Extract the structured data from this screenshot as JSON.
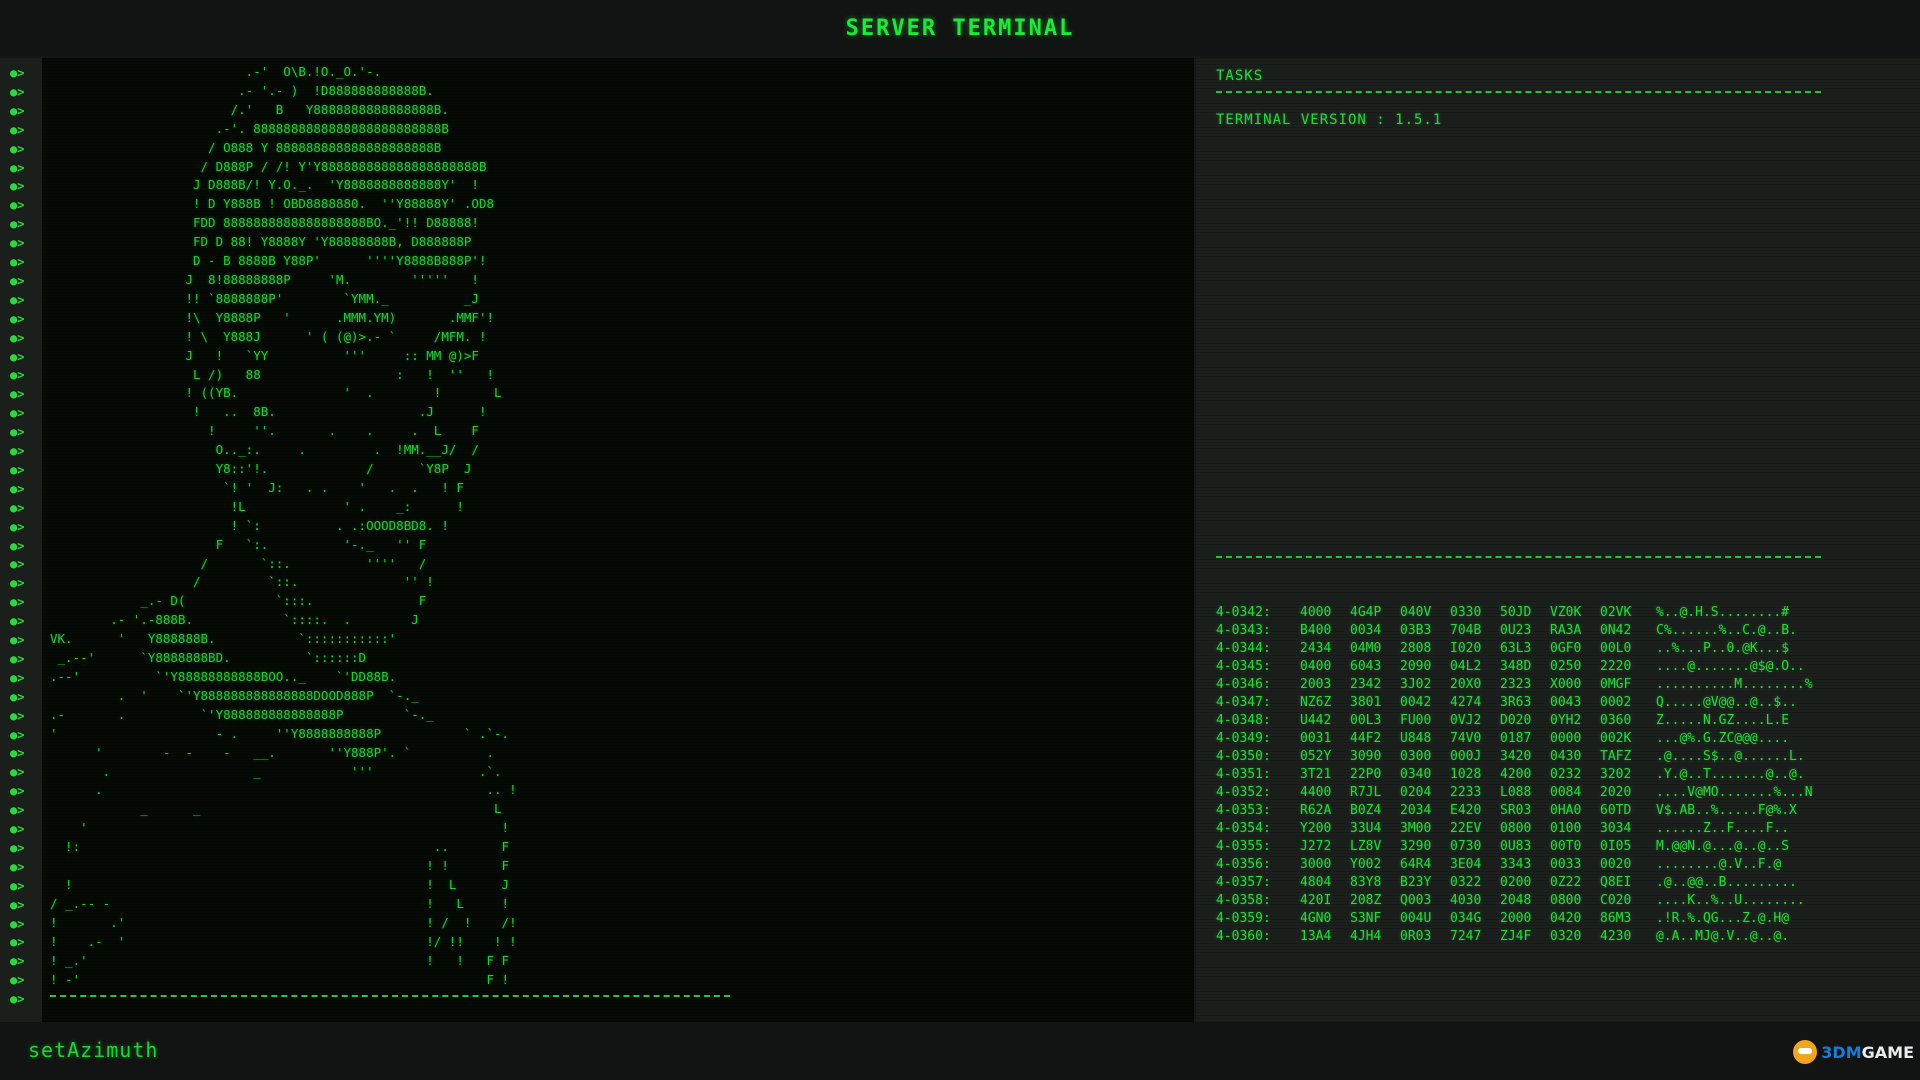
{
  "window": {
    "title": "SERVER TERMINAL"
  },
  "terminal": {
    "prompt_symbol": "●>",
    "line_count": 50,
    "ascii_art": "                          .-'  O\\B.!O._O.'-.\n                         .- '.- )  !D888888888888B.\n                        /.'   B   Y8888888888888888B.\n                      .-'. 8888888888888888888888888B\n                     / O888 Y 888888888888888888888B\n                    / D888P / /! Y'Y888888888888888888888B\n                   J D888B/! Y.O._.  'Y8888888888888Y'  !\n                   ! D Y888B ! OBD8888880.  ''Y88888Y' .OD8\n                   FDD 8888888888888888888BO._'!! D88888!\n                   FD D 88! Y8888Y 'Y88888888B, D888888P\n                   D - B 8888B Y88P'      ''''Y8888B888P'!\n                  J  8!88888888P     'M.        '''''   !\n                  !! `8888888P'        `YMM._          _J\n                  !\\  Y8888P   '      .MMM.YM)       .MMF'!\n                  ! \\  Y888J      ' ( (@)>.- `     /MFM. !\n                  J   !   `YY          '''     :: MM @)>F\n                   L /)   88                  :   !  ''   !\n                  ! ((YB.              '  .        !       L\n                   !   ..  8B.                   .J      !\n                     !     ''.       .    .     .  L    F\n                      O.._:.     .         .  !MM.__J/  /\n                      Y8::'!.             /      `Y8P  J\n                       `! '  J:   . .    '   .  .   ! F\n                        !L             ' .    _:      !\n                        ! `:          . .:OOOD8BD8. !\n                      F   `:.          '-._   '' F\n                    /       `::.          ''''   /\n                   /         `::.              '' !\n            _.- D(            `:::.              F\n        .- '.-888B.            `::::.  .        J\nVK.      '   Y888888B.           `:::::::::::'\n _.--'      `Y8888888BD.          `::::::D\n.--'          `'Y88888888888BOO.._    `'DD88B.\n         .  '    `'Y888888888888888DOOD888P  `-._\n.-       .          `'Y888888888888888P        `-._\n'                     - .     ''Y8888888888P           ` .`-.\n      '        -  -    -   __.       ''Y888P'. `          .\n       .                   _            '''              .`.\n      .                                                   .. !\n            _      _                                       L\n    '                                                       !\n  !:                                               ..       F\n                                                  ! !       F\n  !                                               !  L      J\n/ _.-- -                                          !   L     !\n!       .'                                        ! /  !    /!\n!    .-  '                                        !/ !!    ! !\n! _.'                                             !   !   F F\n! -'                                                      F !"
  },
  "side_panel": {
    "heading": "TASKS",
    "version_text": "TERMINAL VERSION : 1.5.1",
    "hex_rows": [
      {
        "addr": "4-0342:",
        "words": [
          "4000",
          "4G4P",
          "040V",
          "0330",
          "50JD",
          "VZ0K",
          "02VK"
        ],
        "ascii": "%..@.H.S........#"
      },
      {
        "addr": "4-0343:",
        "words": [
          "B400",
          "0034",
          "03B3",
          "704B",
          "0U23",
          "RA3A",
          "0N42"
        ],
        "ascii": "C%......%..C.@..B."
      },
      {
        "addr": "4-0344:",
        "words": [
          "2434",
          "04M0",
          "2808",
          "I020",
          "63L3",
          "0GF0",
          "00L0"
        ],
        "ascii": "..%...P..0.@K...$"
      },
      {
        "addr": "4-0345:",
        "words": [
          "0400",
          "6043",
          "2090",
          "04L2",
          "348D",
          "0250",
          "2220"
        ],
        "ascii": "....@.......@$@.O.."
      },
      {
        "addr": "4-0346:",
        "words": [
          "2003",
          "2342",
          "3J02",
          "20X0",
          "2323",
          "X000",
          "0MGF"
        ],
        "ascii": "..........M........%"
      },
      {
        "addr": "4-0347:",
        "words": [
          "NZ6Z",
          "3801",
          "0042",
          "4274",
          "3R63",
          "0043",
          "0002"
        ],
        "ascii": "Q.....@V@@..@..$.."
      },
      {
        "addr": "4-0348:",
        "words": [
          "U442",
          "00L3",
          "FU00",
          "0VJ2",
          "D020",
          "0YH2",
          "0360"
        ],
        "ascii": "Z.....N.GZ....L.E"
      },
      {
        "addr": "4-0349:",
        "words": [
          "0031",
          "44F2",
          "U848",
          "74V0",
          "0187",
          "0000",
          "002K"
        ],
        "ascii": "...@%.G.ZC@@@...."
      },
      {
        "addr": "4-0350:",
        "words": [
          "052Y",
          "3090",
          "0300",
          "000J",
          "3420",
          "0430",
          "TAFZ"
        ],
        "ascii": ".@....S$..@......L."
      },
      {
        "addr": "4-0351:",
        "words": [
          "3T21",
          "22P0",
          "0340",
          "1028",
          "4200",
          "0232",
          "3202"
        ],
        "ascii": ".Y.@..T.......@..@."
      },
      {
        "addr": "4-0352:",
        "words": [
          "4400",
          "R7JL",
          "0204",
          "2233",
          "L088",
          "0084",
          "2020"
        ],
        "ascii": "....V@MO.......%...N"
      },
      {
        "addr": "4-0353:",
        "words": [
          "R62A",
          "B0Z4",
          "2034",
          "E420",
          "SR03",
          "0HA0",
          "60TD"
        ],
        "ascii": "V$.AB..%.....F@%.X"
      },
      {
        "addr": "4-0354:",
        "words": [
          "Y200",
          "33U4",
          "3M00",
          "22EV",
          "0800",
          "0100",
          "3034"
        ],
        "ascii": "......Z..F....F.."
      },
      {
        "addr": "4-0355:",
        "words": [
          "J272",
          "LZ8V",
          "3290",
          "0730",
          "0U83",
          "00T0",
          "0I05"
        ],
        "ascii": "M.@@N.@...@..@..S"
      },
      {
        "addr": "4-0356:",
        "words": [
          "3000",
          "Y002",
          "64R4",
          "3E04",
          "3343",
          "0033",
          "0020"
        ],
        "ascii": "........@.V..F.@"
      },
      {
        "addr": "4-0357:",
        "words": [
          "4804",
          "83Y8",
          "B23Y",
          "0322",
          "0200",
          "0Z22",
          "Q8EI"
        ],
        "ascii": ".@..@@..B........."
      },
      {
        "addr": "4-0358:",
        "words": [
          "420I",
          "208Z",
          "Q003",
          "4030",
          "2048",
          "0800",
          "C020"
        ],
        "ascii": "....K..%..U........"
      },
      {
        "addr": "4-0359:",
        "words": [
          "4GN0",
          "S3NF",
          "004U",
          "034G",
          "2000",
          "0420",
          "86M3"
        ],
        "ascii": ".!R.%.QG...Z.@.H@"
      },
      {
        "addr": "4-0360:",
        "words": [
          "13A4",
          "4JH4",
          "0R03",
          "7247",
          "ZJ4F",
          "0320",
          "4230"
        ],
        "ascii": "@.A..MJ@.V..@..@."
      }
    ]
  },
  "command_bar": {
    "command": "setAzimuth"
  },
  "watermark": {
    "brand": "3DM",
    "suffix": "GAME"
  },
  "colors": {
    "terminal_green": "#27c83b",
    "title_green": "#1ee83a",
    "terminal_bg": "#050a05",
    "side_bg": "#1c201d"
  }
}
